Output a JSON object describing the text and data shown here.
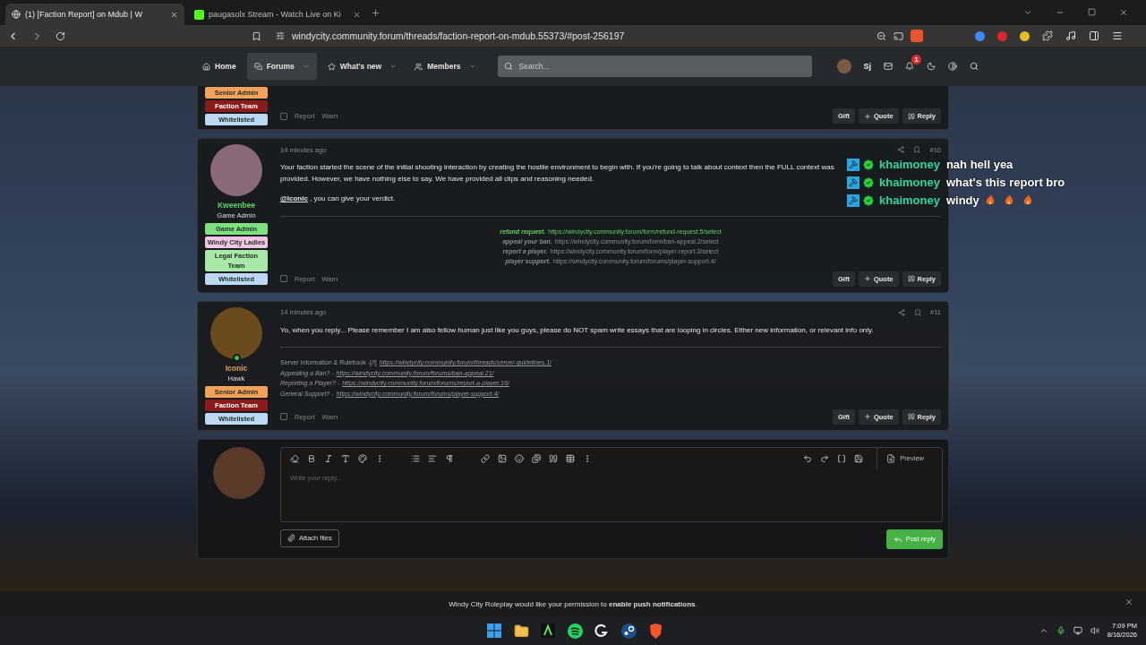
{
  "browser": {
    "tabs": [
      {
        "title": "(1) [Faction Report] on Mdub | W",
        "selected": true
      },
      {
        "title": "paugasolx Stream - Watch Live on Ki",
        "selected": false
      }
    ],
    "url": "windycity.community.forum/threads/faction-report-on-mdub.55373/#post-256197"
  },
  "nav": {
    "items": [
      {
        "label": "Home",
        "selected": false,
        "dropdown": false
      },
      {
        "label": "Forums",
        "selected": true,
        "dropdown": true
      },
      {
        "label": "What's new",
        "selected": false,
        "dropdown": true
      },
      {
        "label": "Members",
        "selected": false,
        "dropdown": true
      }
    ],
    "search_placeholder": "Search...",
    "user_initials": "Sj",
    "alert_count": "1"
  },
  "posts": [
    {
      "badges": [
        {
          "label": "Senior Admin",
          "color": "#f2a25a"
        },
        {
          "label": "Faction Team",
          "color": "#8c1c1c"
        },
        {
          "label": "Whitelisted",
          "color": "#bcd8f2"
        }
      ],
      "selected": false,
      "footer_left": [
        "Report",
        "Warn"
      ],
      "footer_right": [
        {
          "label": "Gift",
          "kind": "plain"
        },
        {
          "label": "Quote",
          "kind": "quote"
        },
        {
          "label": "Reply",
          "kind": "reply"
        }
      ]
    },
    {
      "author": {
        "name": "Kweenbee",
        "title": "Game Admin",
        "color": "#5fd35f",
        "online": false
      },
      "badges": [
        {
          "label": "Game Admin",
          "color": "#7fe07f"
        },
        {
          "label": "Windy City Ladies",
          "color": "#f3c4e4"
        },
        {
          "label": "Legal Faction Team",
          "color": "#a7e8a7"
        },
        {
          "label": "Whitelisted",
          "color": "#bcd8f2"
        }
      ],
      "selected": false,
      "time": "14 minutes ago",
      "number": "#10",
      "paragraphs": [
        {
          "kind": "text",
          "text": "Your faction started the scene of the initial shooting interaction by creating the hostile environment to begin with. If you're going to talk about context then the FULL context was provided. However, we have nothing else to say. We have provided all clips and reasoning needed."
        },
        {
          "kind": "mention",
          "mention": "@Iconic",
          "text": " , you can give your verdict."
        }
      ],
      "centered_links": [
        {
          "label": "refund request.",
          "url": "https://windycity.community.forum/form/refund-request.5/select",
          "color": "#5fcf5f"
        },
        {
          "label": "appeal your ban.",
          "url": "https://windycity.community.forum/form/ban-appeal.2/select",
          "color": "#8a8a8a"
        },
        {
          "label": "report a player.",
          "url": "https://windycity.community.forum/form/player-report.3/select",
          "color": "#8a8a8a"
        },
        {
          "label": "player support.",
          "url": "https://windycity.community.forum/forums/player-support.4/",
          "color": "#8a8a8a"
        }
      ],
      "footer_left": [
        "Report",
        "Warn"
      ],
      "footer_right": [
        {
          "label": "Gift",
          "kind": "plain"
        },
        {
          "label": "Quote",
          "kind": "quote"
        },
        {
          "label": "Reply",
          "kind": "reply"
        }
      ]
    },
    {
      "author": {
        "name": "Iconic",
        "title": "Hawk",
        "color": "#e8a04c",
        "online": true
      },
      "badges": [
        {
          "label": "Senior Admin",
          "color": "#f2a25a"
        },
        {
          "label": "Faction Team",
          "color": "#8c1c1c"
        },
        {
          "label": "Whitelisted",
          "color": "#bcd8f2"
        }
      ],
      "selected": false,
      "time": "14 minutes ago",
      "number": "#11",
      "paragraphs": [
        {
          "kind": "text",
          "text": "Yo, when you reply... Please remember I am also fellow human just like you guys, please do NOT spam write essays that are looping in circles. Either new information, or relevant info only."
        }
      ],
      "resource_links": [
        {
          "label": "Server Information & Rulebook -[/!]",
          "url": "https://windycity.community.forum/threads/server-guidelines.1/",
          "italic": false
        },
        {
          "label": "Appealing a Ban? -",
          "url": "https://windycity.community.forum/forums/ban-appeal.21/",
          "italic": true
        },
        {
          "label": "Reporting a Player? -",
          "url": "https://windycity.community.forum/forums/report-a-player.16/",
          "italic": true
        },
        {
          "label": "General Support? -",
          "url": "https://windycity.community.forum/forums/player-support.4/",
          "italic": true
        }
      ],
      "footer_left": [
        "Report",
        "Warn"
      ],
      "footer_right": [
        {
          "label": "Gift",
          "kind": "plain"
        },
        {
          "label": "Quote",
          "kind": "quote"
        },
        {
          "label": "Reply",
          "kind": "reply"
        }
      ]
    }
  ],
  "editor": {
    "placeholder": "Write your reply...",
    "preview": "Preview",
    "attach": "Attach files",
    "submit": "Post reply"
  },
  "chat_overlay": [
    {
      "user": "khaimoney",
      "text": "nah hell yea"
    },
    {
      "user": "khaimoney",
      "text": "what's this report bro"
    },
    {
      "user": "khaimoney",
      "text": "windy",
      "emotes": [
        {
          "kind": "fire"
        },
        {
          "kind": "fire"
        },
        {
          "kind": "fire"
        }
      ]
    }
  ],
  "notification": {
    "text": "Windy City Roleplay would like your permission to **enable push notifications**."
  },
  "taskbar": {
    "time": "7:09 PM",
    "date": "8/16/2026"
  }
}
